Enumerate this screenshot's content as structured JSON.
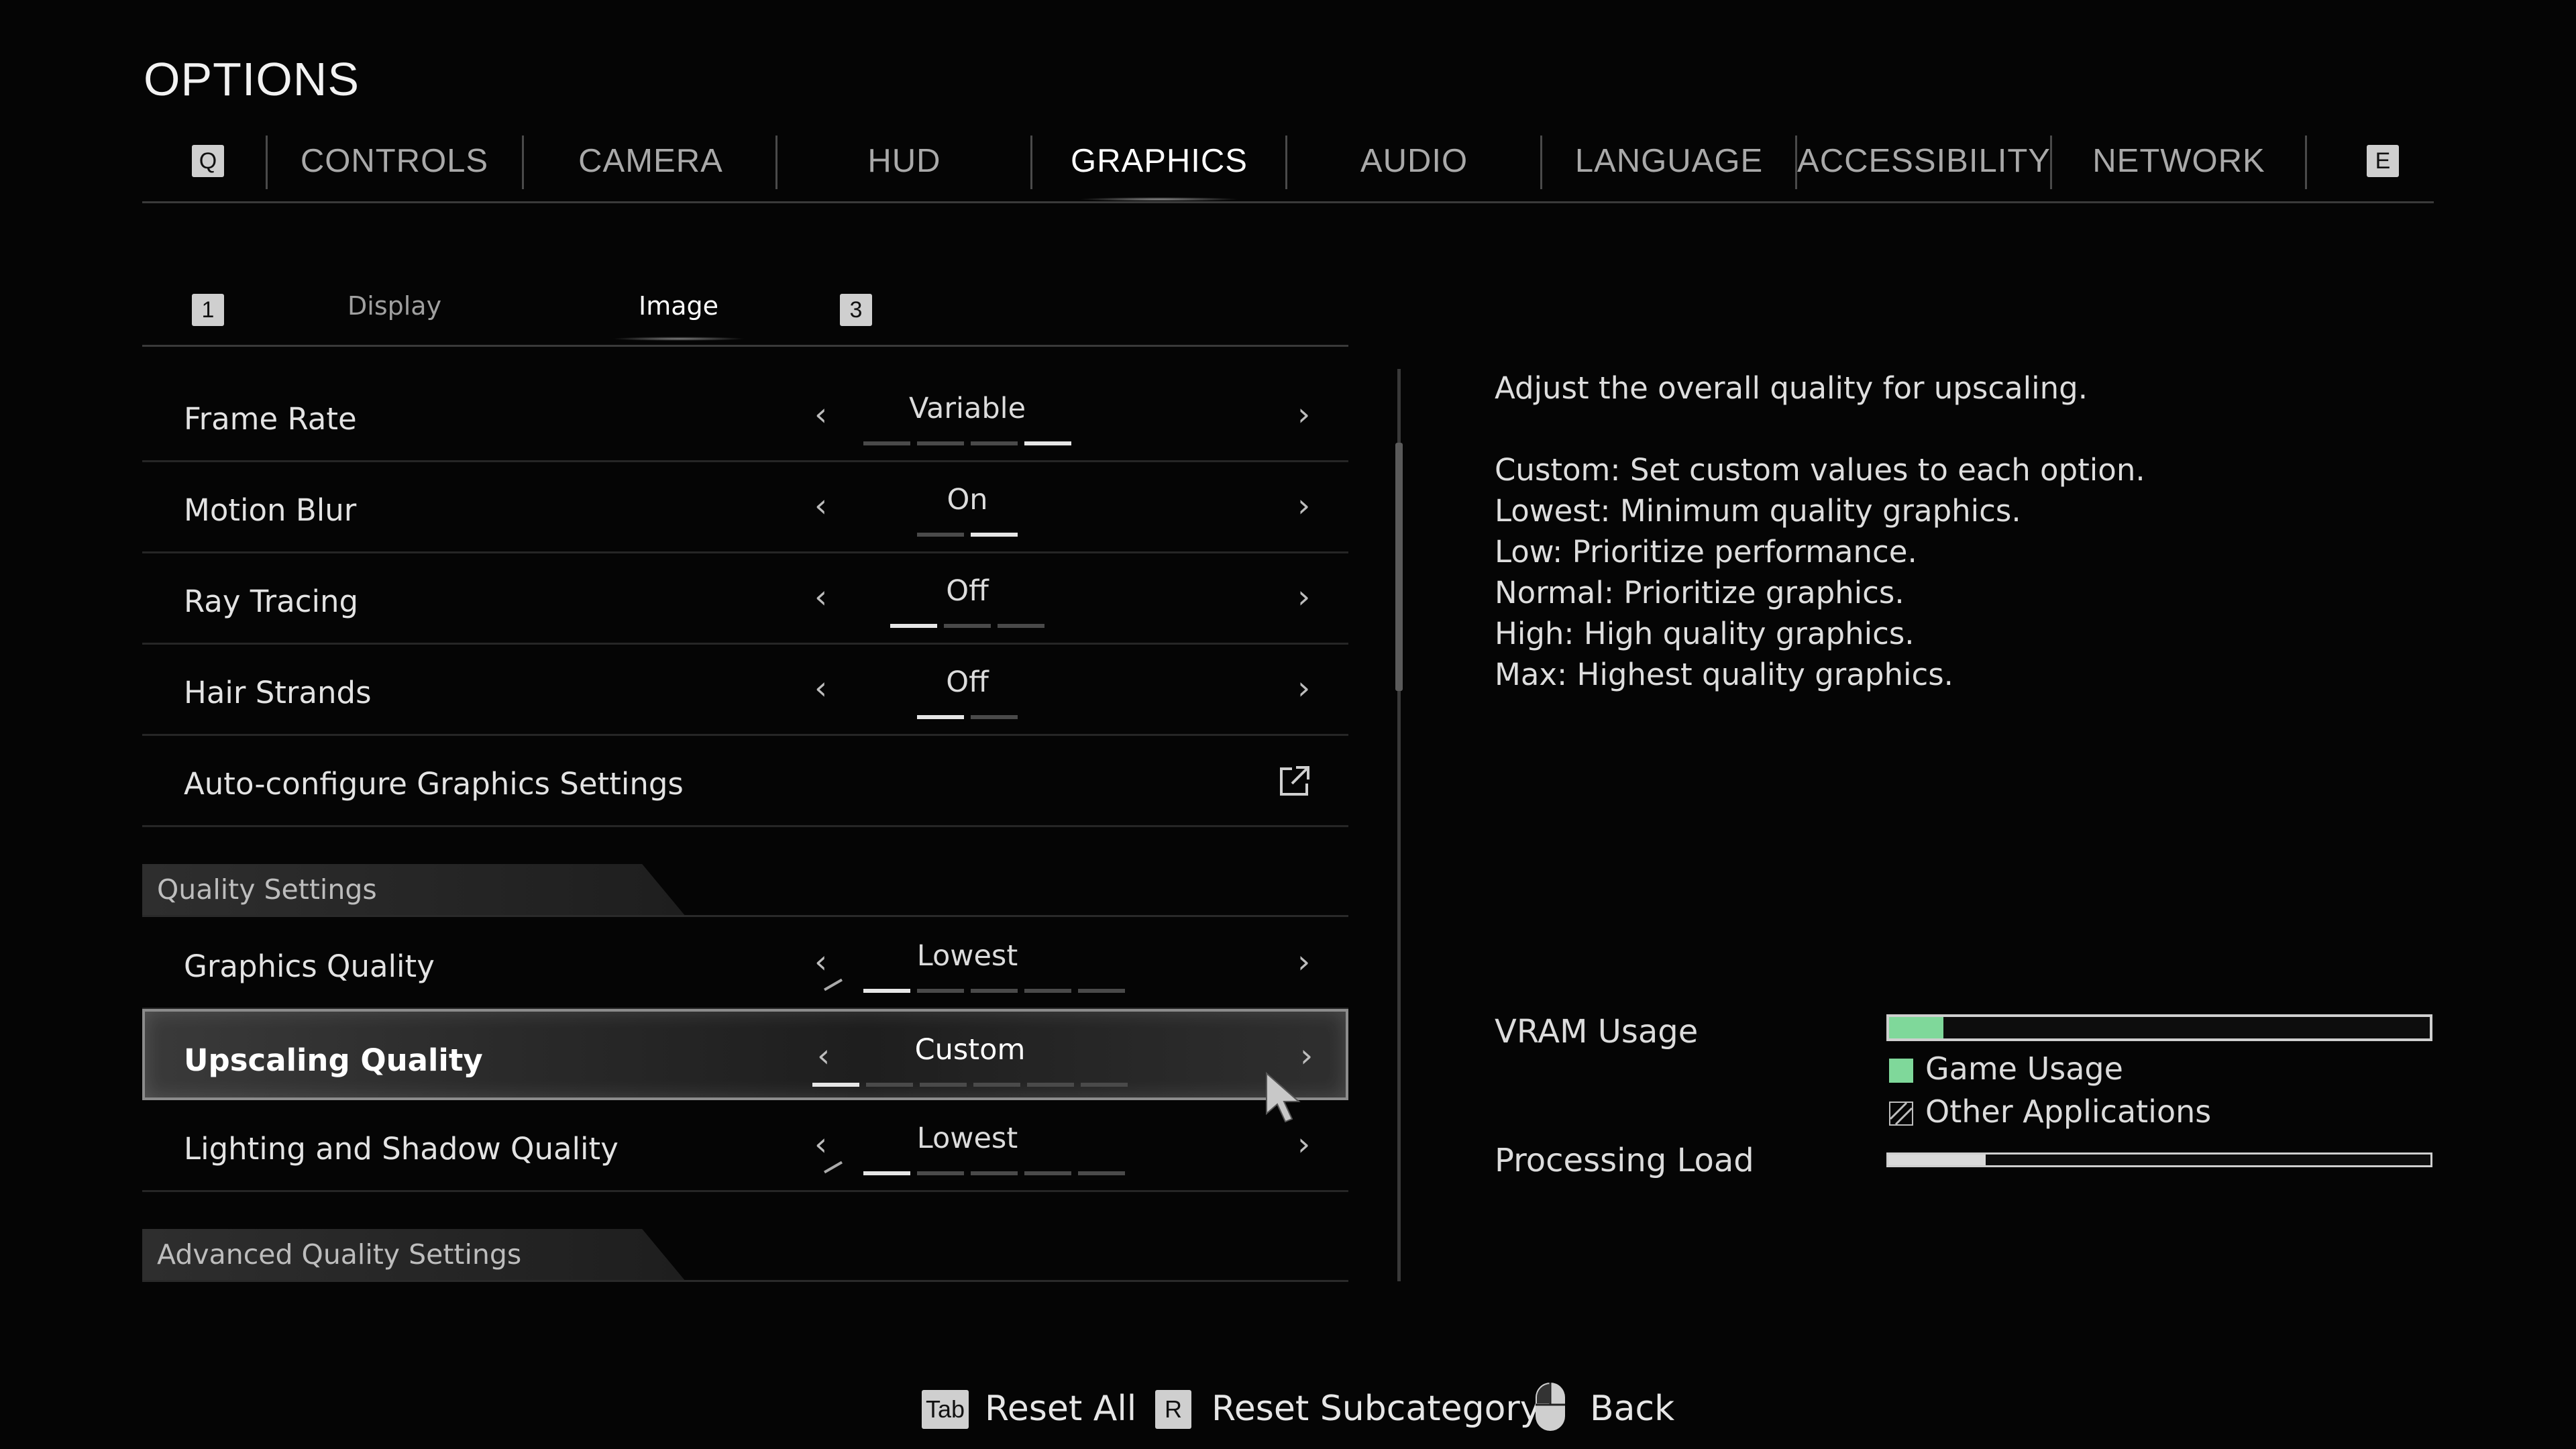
{
  "title": "OPTIONS",
  "tabs": {
    "prev_key": "Q",
    "next_key": "E",
    "items": [
      "CONTROLS",
      "CAMERA",
      "HUD",
      "GRAPHICS",
      "AUDIO",
      "LANGUAGE",
      "ACCESSIBILITY",
      "NETWORK"
    ],
    "active": "GRAPHICS"
  },
  "subtabs": {
    "prev_key": "1",
    "next_key": "3",
    "items": [
      "Display",
      "Image"
    ],
    "active": "Image"
  },
  "settings": {
    "frame_rate": {
      "label": "Frame Rate",
      "value": "Variable",
      "segments": 4,
      "selected": 4
    },
    "motion_blur": {
      "label": "Motion Blur",
      "value": "On",
      "segments": 2,
      "selected": 2
    },
    "ray_tracing": {
      "label": "Ray Tracing",
      "value": "Off",
      "segments": 3,
      "selected": 1
    },
    "hair_strands": {
      "label": "Hair Strands",
      "value": "Off",
      "segments": 2,
      "selected": 1
    },
    "auto_configure": {
      "label": "Auto-configure Graphics Settings"
    },
    "quality_header": "Quality Settings",
    "graphics_quality": {
      "label": "Graphics Quality",
      "value": "Lowest",
      "segments": 6,
      "selected": 2
    },
    "upscaling_quality": {
      "label": "Upscaling Quality",
      "value": "Custom",
      "segments": 6,
      "selected": 1
    },
    "lighting_quality": {
      "label": "Lighting and Shadow Quality",
      "value": "Lowest",
      "segments": 6,
      "selected": 2
    },
    "advanced_header": "Advanced Quality Settings"
  },
  "description": {
    "intro": "Adjust the overall quality for upscaling.",
    "lines": [
      "Custom: Set custom values to each option.",
      "Lowest: Minimum quality graphics.",
      "Low: Prioritize performance.",
      "Normal: Prioritize graphics.",
      "High: High quality graphics.",
      "Max: Highest quality graphics."
    ]
  },
  "vram": {
    "label": "VRAM Usage",
    "game_usage_fraction": 0.1,
    "legend_game": "Game Usage",
    "legend_other": "Other Applications",
    "game_color": "#7fd89a"
  },
  "processing": {
    "label": "Processing Load",
    "load_fraction": 0.18
  },
  "footer": {
    "reset_all_key": "Tab",
    "reset_all": "Reset All",
    "reset_sub_key": "R",
    "reset_sub": "Reset Subcategory",
    "back": "Back"
  }
}
